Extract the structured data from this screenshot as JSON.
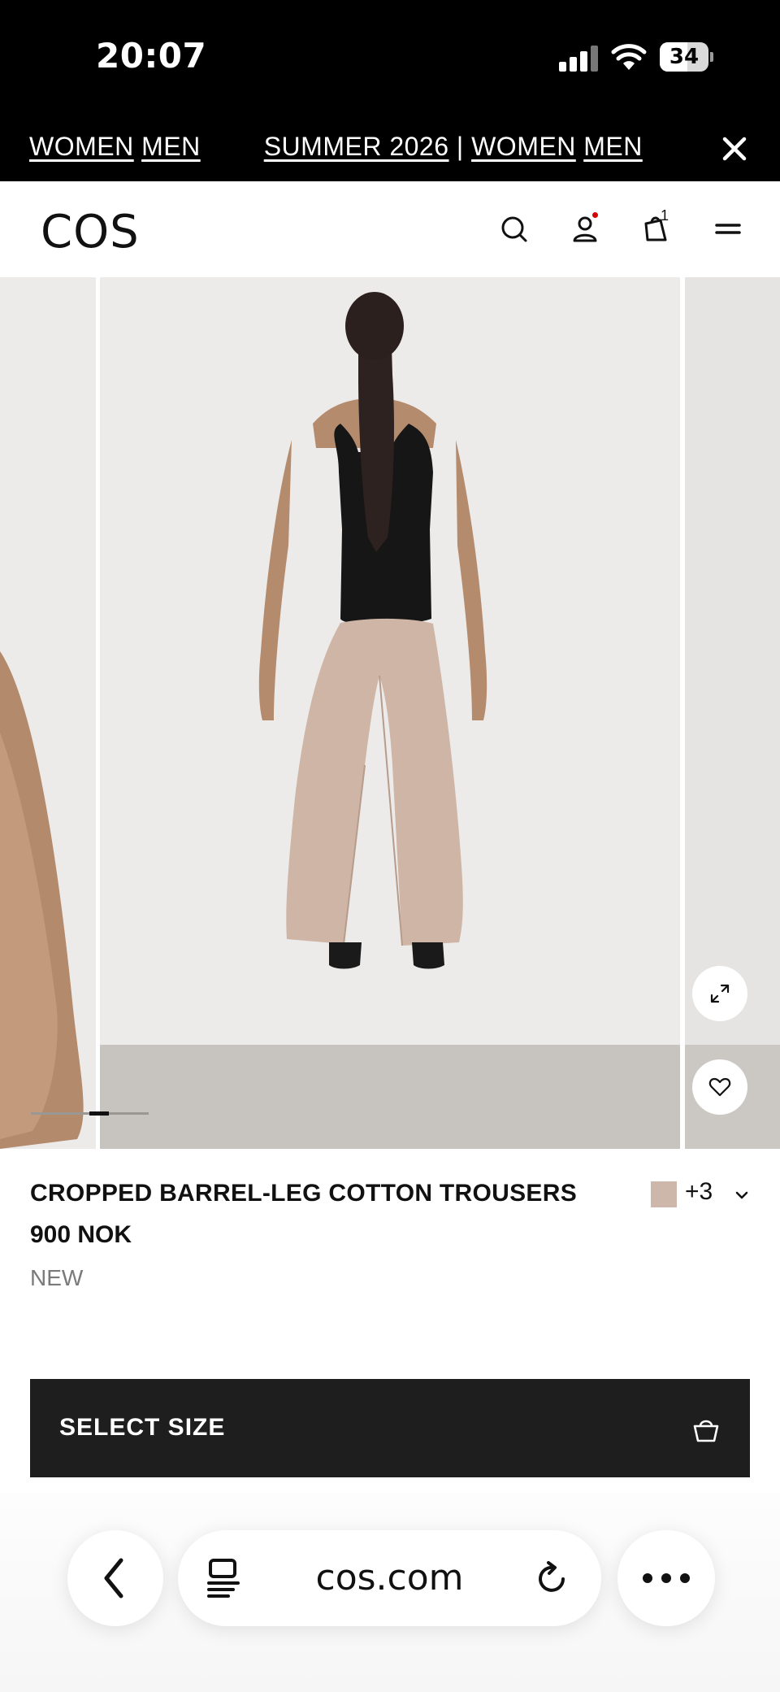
{
  "status_bar": {
    "time": "20:07",
    "battery": "34"
  },
  "promo": {
    "items": [
      "WOMEN",
      "MEN",
      "SUMMER 2026",
      "WOMEN",
      "MEN"
    ],
    "separator": "|"
  },
  "header": {
    "logo": "COS",
    "bag_count": "1"
  },
  "gallery": {
    "slide_count": 5,
    "active_slide": 3
  },
  "product": {
    "title": "CROPPED BARREL-LEG COTTON TROUSERS",
    "price": "900 NOK",
    "badge": "NEW",
    "swatch_color": "#cdb6aa",
    "more_colors": "+3"
  },
  "cta": {
    "label": "SELECT SIZE"
  },
  "browser": {
    "url": "cos.com"
  }
}
